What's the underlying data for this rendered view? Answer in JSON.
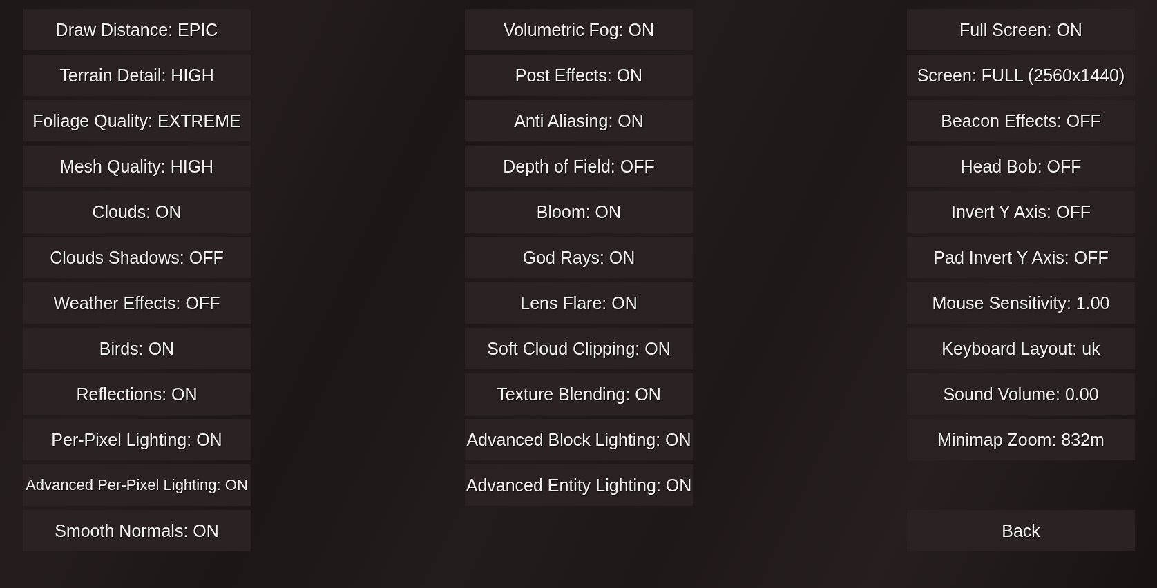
{
  "columns": [
    {
      "buttons": [
        {
          "label": "Draw Distance: EPIC"
        },
        {
          "label": "Terrain Detail: HIGH"
        },
        {
          "label": "Foliage Quality: EXTREME"
        },
        {
          "label": "Mesh Quality: HIGH"
        },
        {
          "label": "Clouds: ON"
        },
        {
          "label": "Clouds Shadows: OFF"
        },
        {
          "label": "Weather Effects: OFF"
        },
        {
          "label": "Birds: ON"
        },
        {
          "label": "Reflections: ON"
        },
        {
          "label": "Per-Pixel Lighting: ON"
        },
        {
          "label": "Advanced Per-Pixel Lighting: ON"
        },
        {
          "label": "Smooth Normals: ON"
        }
      ]
    },
    {
      "buttons": [
        {
          "label": "Volumetric Fog: ON"
        },
        {
          "label": "Post Effects: ON"
        },
        {
          "label": "Anti Aliasing: ON"
        },
        {
          "label": "Depth of Field: OFF"
        },
        {
          "label": "Bloom: ON"
        },
        {
          "label": "God Rays: ON"
        },
        {
          "label": "Lens Flare: ON"
        },
        {
          "label": "Soft Cloud Clipping: ON"
        },
        {
          "label": "Texture Blending: ON"
        },
        {
          "label": "Advanced Block Lighting: ON"
        },
        {
          "label": "Advanced Entity Lighting: ON"
        }
      ]
    },
    {
      "buttons": [
        {
          "label": "Full Screen: ON"
        },
        {
          "label": "Screen: FULL (2560x1440)"
        },
        {
          "label": "Beacon Effects: OFF"
        },
        {
          "label": "Head Bob: OFF"
        },
        {
          "label": "Invert Y Axis: OFF"
        },
        {
          "label": "Pad Invert Y Axis: OFF"
        },
        {
          "label": "Mouse Sensitivity: 1.00"
        },
        {
          "label": "Keyboard Layout: uk"
        },
        {
          "label": "Sound Volume: 0.00"
        },
        {
          "label": "Minimap Zoom: 832m"
        }
      ]
    }
  ],
  "back_button": {
    "label": "Back"
  }
}
